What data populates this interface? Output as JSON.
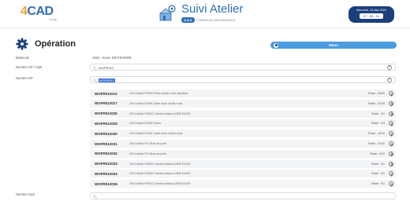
{
  "header": {
    "logo_prefix": "4",
    "logo_main": "CAD",
    "logo_tagline": "Group",
    "app_title": "Suivi Atelier",
    "app_badge": "A.S.A",
    "app_subtitle": "CONNEXION SANS ANOMALIE",
    "date": "Mercredi, 13 Mai 2020",
    "time": "07 : 54 : 41"
  },
  "page": {
    "title": "Opération",
    "menu_label": "Menu"
  },
  "form": {
    "matricule_label": "Matricule",
    "matricule_value": "1910 - Kevin DETHIVIERE",
    "numero_of_opti_label": "Numéro OF / Opti",
    "numero_of_opti_value": "WOFR012",
    "numero_of_label": "Numéro OF",
    "numero_of_value": "WOFR012",
    "numero_opti_label": "Numéro Opti",
    "numero_opti_value": ""
  },
  "dropdown": [
    {
      "code": "WOFR012012",
      "desc": "1910 Article FM000 Pièce adulte route standard",
      "reste": "Reste : 25/20"
    },
    {
      "code": "WOFR012017",
      "desc": "1910 Article 57960 Cadre acier adulte route",
      "reste": "Reste : 32/20"
    },
    {
      "code": "WOFR012025",
      "desc": "1910 Article FM000 Chariot ravitaux A/B30 EA200",
      "reste": "Reste : 0/1"
    },
    {
      "code": "WOFR012029",
      "desc": "1910 Article 57960 Fourre",
      "reste": "Reste : 0/3"
    },
    {
      "code": "WOFR012030",
      "desc": "1910 Article 57960 Cadre acier enfant route",
      "reste": "Reste : 10/10"
    },
    {
      "code": "WOFR012031",
      "desc": "1910 Article P11 Bras de porte",
      "reste": "Reste : 20/20"
    },
    {
      "code": "WOFR012032",
      "desc": "1910 Article P11 Bras de porte",
      "reste": "Reste : 5/10"
    },
    {
      "code": "WOFR012033",
      "desc": "1910 Article FM000 Chariot ravitaux A/B30 EA200",
      "reste": "Reste : 0/1"
    },
    {
      "code": "WOFR012034",
      "desc": "1910 Article FM000 Chariot ravitaux A/B30 EA200",
      "reste": "Reste : 0/1"
    },
    {
      "code": "WOFR012036",
      "desc": "1910 Article FM000 Chariot ravitaux A/B30 EA200",
      "reste": "Reste : 0/1"
    }
  ],
  "colors": {
    "brand_blue": "#2d6fb3",
    "menu_blue": "#4a9be0",
    "dark_navy": "#1b3f7a",
    "logo_orange": "#e8a43a",
    "selection_blue": "#3b6fd6"
  }
}
